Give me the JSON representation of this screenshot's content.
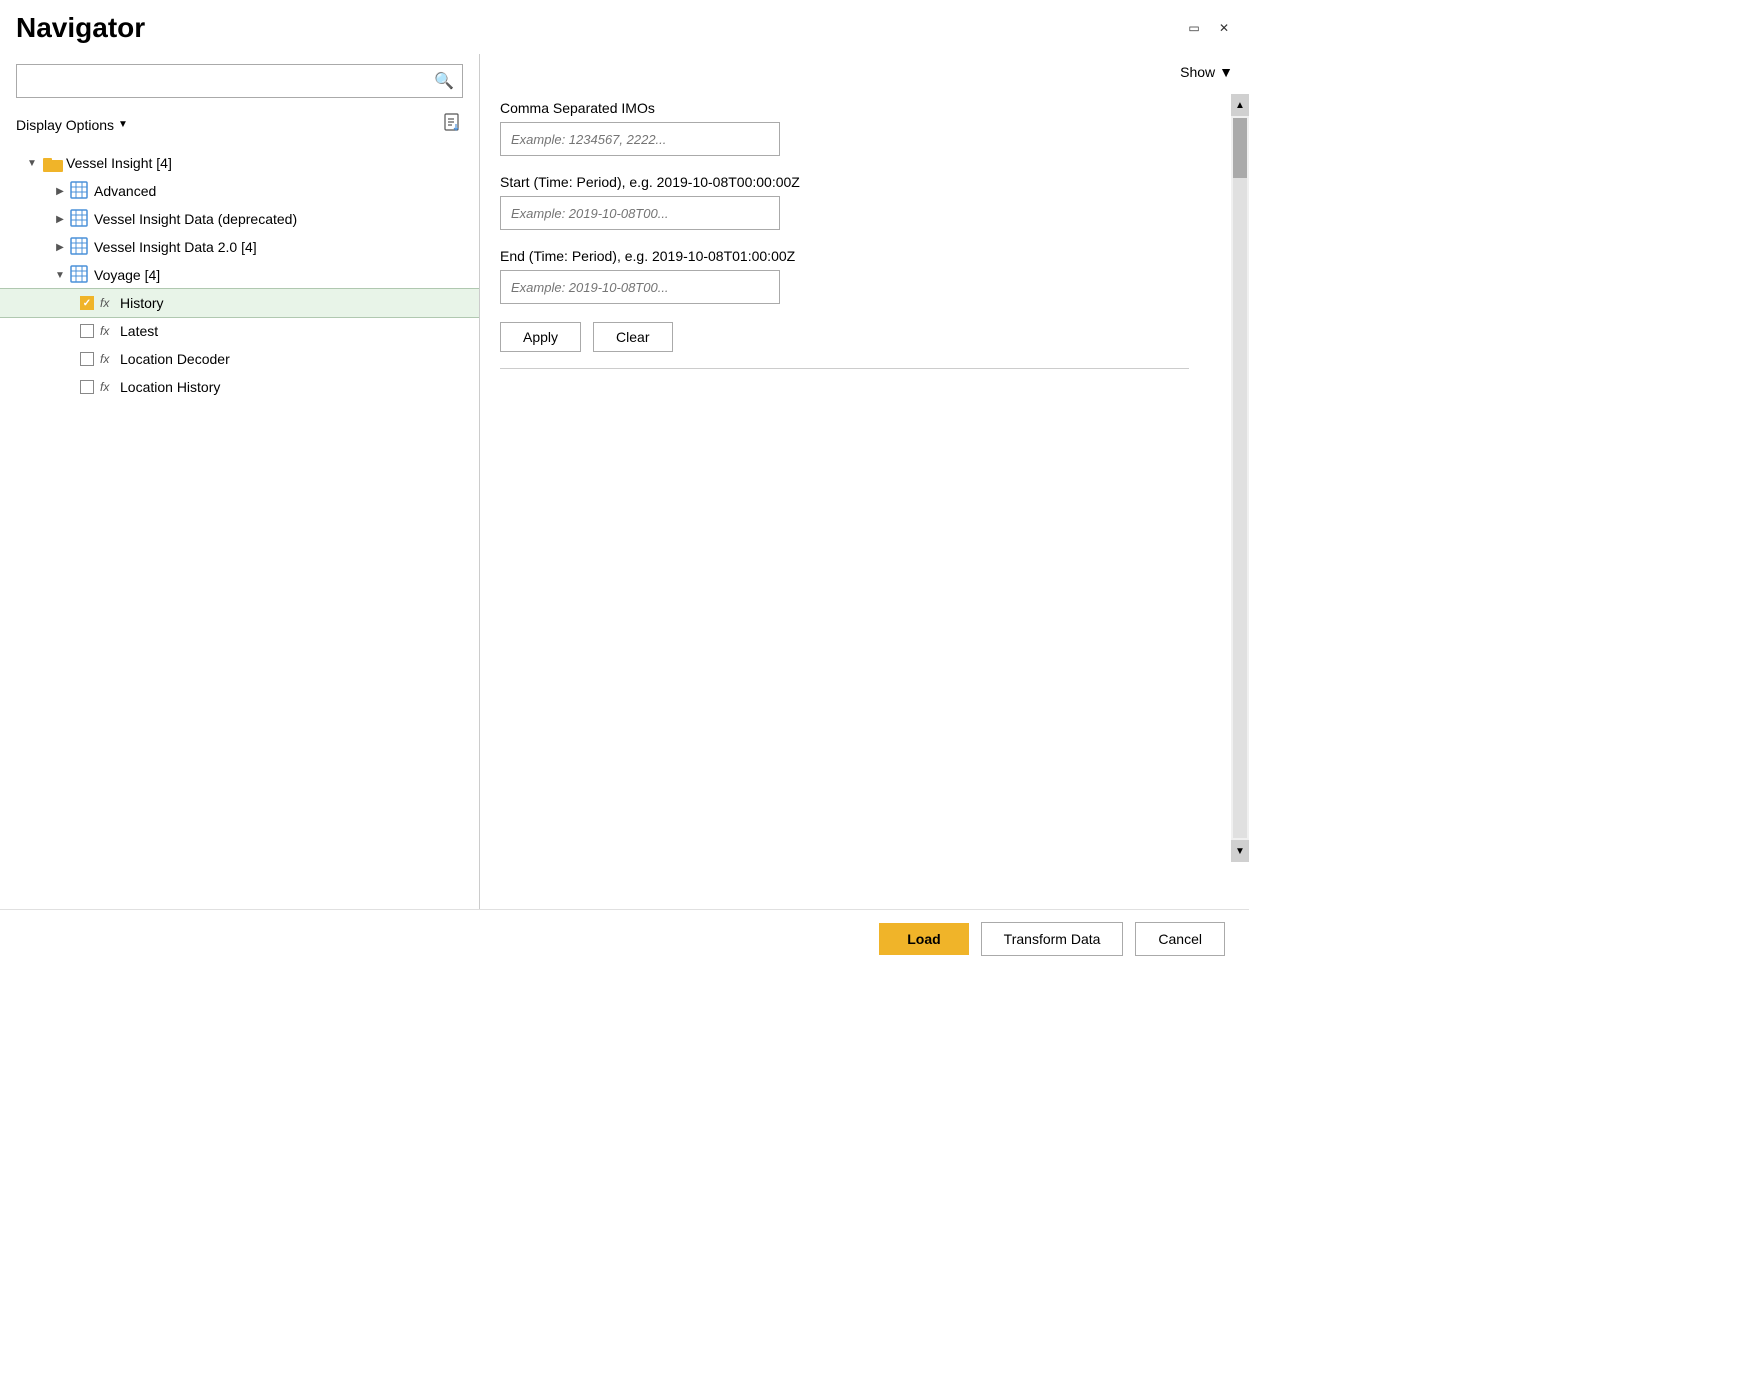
{
  "window": {
    "title": "Navigator",
    "controls": {
      "minimize": "🗖",
      "close": "✕"
    }
  },
  "left_panel": {
    "search_placeholder": "",
    "display_options_label": "Display Options",
    "tree": {
      "root": {
        "label": "Vessel Insight [4]",
        "expanded": true,
        "children": [
          {
            "label": "Advanced",
            "type": "table",
            "expanded": false
          },
          {
            "label": "Vessel Insight Data (deprecated)",
            "type": "table",
            "expanded": false
          },
          {
            "label": "Vessel Insight Data 2.0 [4]",
            "type": "table",
            "expanded": false
          },
          {
            "label": "Voyage [4]",
            "type": "table",
            "expanded": true,
            "children": [
              {
                "label": "History",
                "type": "function",
                "checked": true,
                "selected": true
              },
              {
                "label": "Latest",
                "type": "function",
                "checked": false
              },
              {
                "label": "Location Decoder",
                "type": "function",
                "checked": false
              },
              {
                "label": "Location History",
                "type": "function",
                "checked": false
              }
            ]
          }
        ]
      }
    }
  },
  "right_panel": {
    "show_label": "Show",
    "fields": [
      {
        "label": "Comma Separated IMOs",
        "placeholder": "Example: 1234567, 2222..."
      },
      {
        "label": "Start (Time: Period), e.g. 2019-10-08T00:00:00Z",
        "placeholder": "Example: 2019-10-08T00..."
      },
      {
        "label": "End (Time: Period), e.g. 2019-10-08T01:00:00Z",
        "placeholder": "Example: 2019-10-08T00..."
      }
    ],
    "apply_label": "Apply",
    "clear_label": "Clear"
  },
  "bottom_bar": {
    "load_label": "Load",
    "transform_label": "Transform Data",
    "cancel_label": "Cancel"
  }
}
